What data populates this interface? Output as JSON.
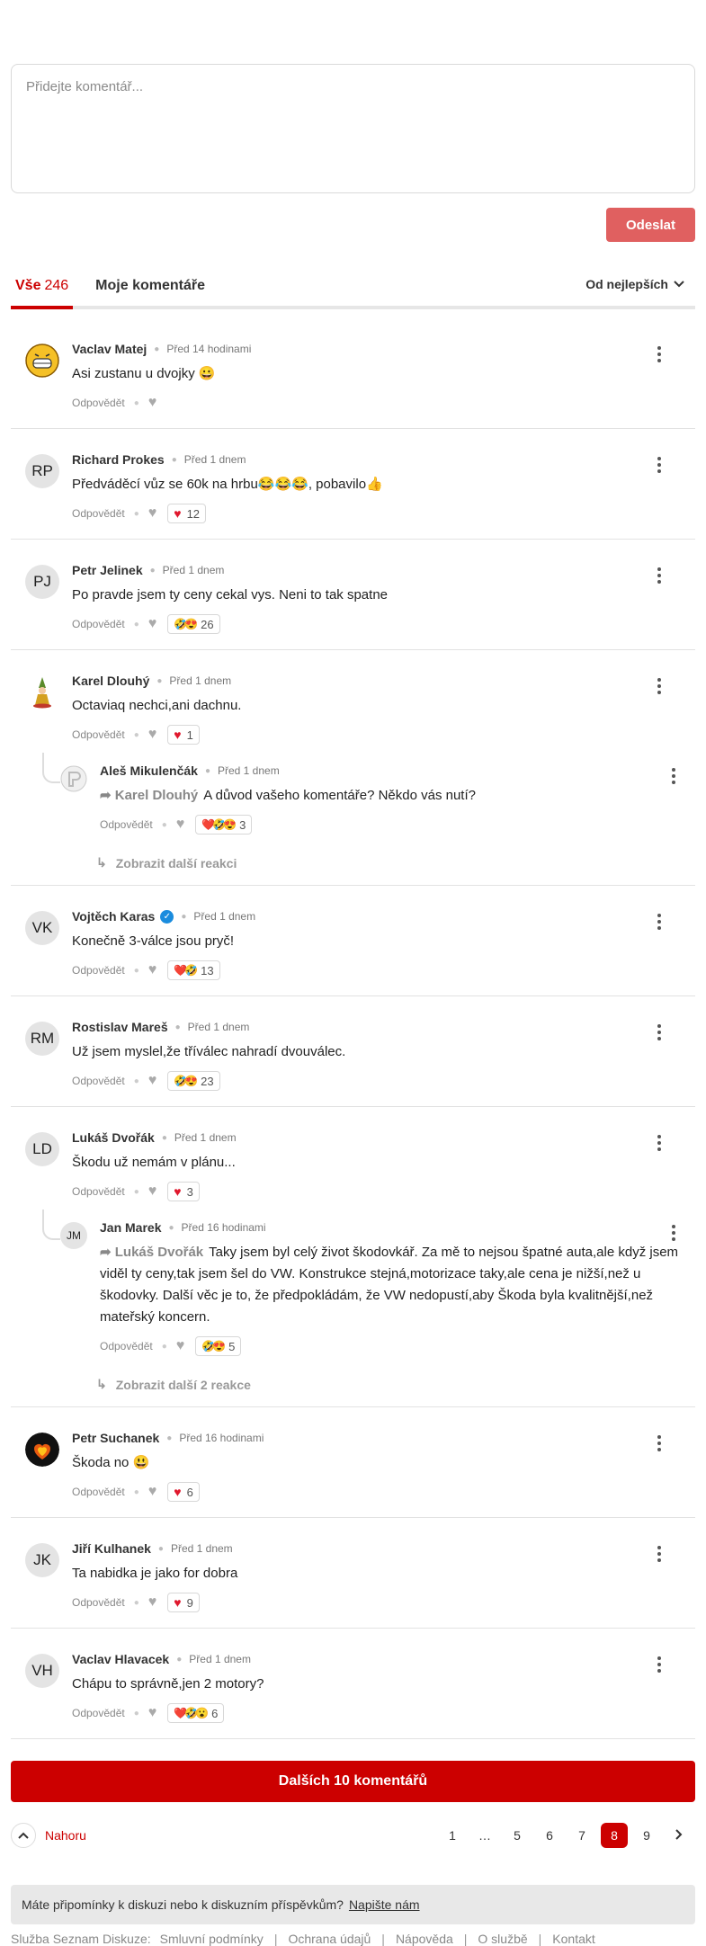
{
  "composer": {
    "placeholder": "Přidejte komentář...",
    "send_label": "Odeslat"
  },
  "tabs": [
    {
      "label": "Vše",
      "count": "246"
    },
    {
      "label": "Moje komentáře"
    }
  ],
  "sort_label": "Od nejlepších",
  "reply_label": "Odpovědět",
  "comments": [
    {
      "initials": "",
      "name": "Vaclav Matej",
      "time": "Před 14 hodinami",
      "text": "Asi zustanu u dvojky 😀",
      "reactions": ""
    },
    {
      "initials": "RP",
      "name": "Richard Prokes",
      "time": "Před 1 dnem",
      "text": "Předváděcí vůz se 60k na hrbu😂😂😂, pobavilo👍",
      "reactions": "12"
    },
    {
      "initials": "PJ",
      "name": "Petr Jelinek",
      "time": "Před 1 dnem",
      "text": "Po pravde jsem ty ceny cekal vys. Neni to tak spatne",
      "reactions": "26",
      "emojis": "🤣😍"
    },
    {
      "initials": "",
      "name": "Karel Dlouhý",
      "time": "Před 1 dnem",
      "text": "Octaviaq nechci,ani dachnu.",
      "reactions": "1",
      "reply": {
        "initials": "",
        "name": "Aleš Mikulenčák",
        "time": "Před 1 dnem",
        "reply_to": "Karel Dlouhý",
        "text": "A důvod vašeho komentáře? Někdo vás nutí?",
        "reactions": "3",
        "emojis": "❤️🤣😍"
      },
      "more": "Zobrazit další reakci"
    },
    {
      "initials": "VK",
      "name": "Vojtěch Karas",
      "time": "Před 1 dnem",
      "text": "Konečně 3-válce jsou pryč!",
      "reactions": "13",
      "emojis": "❤️🤣"
    },
    {
      "initials": "RM",
      "name": "Rostislav Mareš",
      "time": "Před 1 dnem",
      "text": "Už jsem myslel,že tříválec nahradí dvouválec.",
      "reactions": "23",
      "emojis": "🤣😍"
    },
    {
      "initials": "LD",
      "name": "Lukáš Dvořák",
      "time": "Před 1 dnem",
      "text": "Škodu už nemám v plánu...",
      "reactions": "3",
      "reply": {
        "initials": "JM",
        "name": "Jan Marek",
        "time": "Před 16 hodinami",
        "reply_to": "Lukáš Dvořák",
        "text": "Taky jsem byl celý život škodovkář. Za mě to nejsou špatné auta,ale když jsem viděl ty ceny,tak jsem šel do VW. Konstrukce stejná,motorizace taky,ale cena je nižší,než u škodovky. Další věc je to, že předpokládám, že VW nedopustí,aby Škoda byla kvalitnější,než mateřský koncern.",
        "reactions": "5",
        "emojis": "🤣😍"
      },
      "more": "Zobrazit další 2 reakce"
    },
    {
      "initials": "",
      "name": "Petr Suchanek",
      "time": "Před 16 hodinami",
      "text": "Škoda no 😃",
      "reactions": "6"
    },
    {
      "initials": "JK",
      "name": "Jiří Kulhanek",
      "time": "Před 1 dnem",
      "text": "Ta nabidka je jako for dobra",
      "reactions": "9"
    },
    {
      "initials": "VH",
      "name": "Vaclav Hlavacek",
      "time": "Před 1 dnem",
      "text": "Chápu to správně,jen 2 motory?",
      "reactions": "6",
      "emojis": "❤️🤣😮"
    }
  ],
  "load_more_label": "Dalších 10 komentářů",
  "top_label": "Nahoru",
  "pages": [
    "1",
    "…",
    "5",
    "6",
    "7",
    "8",
    "9"
  ],
  "current_page": "8",
  "feedback": {
    "text": "Máte připomínky k diskuzi nebo k diskuzním příspěvkům?",
    "link": "Napište nám"
  },
  "footer": {
    "service": "Služba Seznam Diskuze:",
    "links": [
      "Smluvní podmínky",
      "Ochrana údajů",
      "Nápověda",
      "O službě",
      "Kontakt"
    ]
  },
  "colors": {
    "accent": "#cc0000",
    "send_button": "#e06060",
    "heart": "#e0182d"
  }
}
